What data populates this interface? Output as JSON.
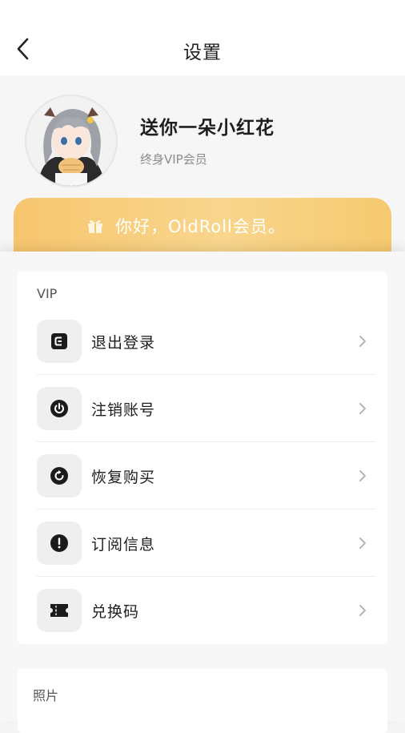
{
  "header": {
    "title": "设置",
    "back_icon": "chevron-left-icon"
  },
  "profile": {
    "username": "送你一朵小红花",
    "membership": "终身VIP会员"
  },
  "banner": {
    "gift_icon": "gift-icon",
    "text": "你好，OldRoll会员。"
  },
  "vip_section": {
    "title": "VIP",
    "items": [
      {
        "label": "退出登录",
        "icon": "logout-icon"
      },
      {
        "label": "注销账号",
        "icon": "power-icon"
      },
      {
        "label": "恢复购买",
        "icon": "restore-icon"
      },
      {
        "label": "订阅信息",
        "icon": "info-icon"
      },
      {
        "label": "兑换码",
        "icon": "ticket-icon"
      }
    ]
  },
  "photo_section": {
    "title": "照片"
  },
  "colors": {
    "banner_gradient_start": "#f7c56e",
    "banner_gradient_end": "#f8d68d",
    "background": "#f5f5f5"
  }
}
